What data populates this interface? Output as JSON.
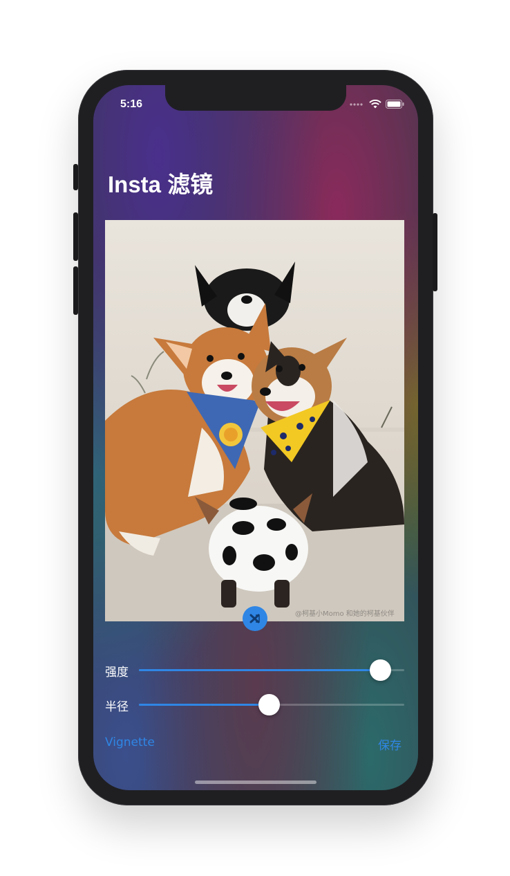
{
  "status_bar": {
    "time": "5:16"
  },
  "header": {
    "title": "Insta 滤镜"
  },
  "photo": {
    "watermark": "@柯基小Momo 和她的柯基伙伴"
  },
  "sliders": [
    {
      "label": "强度",
      "value": 0.92
    },
    {
      "label": "半径",
      "value": 0.5
    }
  ],
  "bottom_bar": {
    "filter_label": "Vignette",
    "save_label": "保存"
  },
  "colors": {
    "accent": "#2f86e5",
    "text": "#ffffff"
  },
  "icons": {
    "filter_button": "shuffle-icon"
  }
}
